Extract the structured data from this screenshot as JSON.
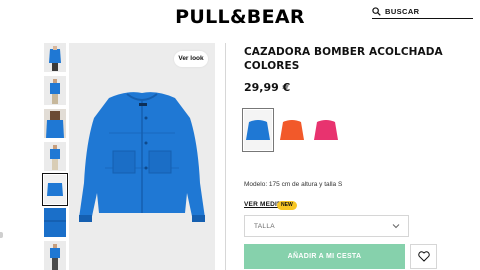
{
  "header": {
    "logo_text": "PULL&BEAR",
    "search_placeholder": "BUSCAR"
  },
  "gallery": {
    "thumbnails": [
      {
        "name": "thumb-front-view"
      },
      {
        "name": "thumb-model-front"
      },
      {
        "name": "thumb-model-close"
      },
      {
        "name": "thumb-model-side"
      },
      {
        "name": "thumb-jacket-flat",
        "selected": true
      },
      {
        "name": "thumb-detail-blue"
      },
      {
        "name": "thumb-model-full"
      }
    ],
    "ver_look_label": "Ver look"
  },
  "product": {
    "title": "CAZADORA BOMBER ACOLCHADA COLORES",
    "price": "29,99 €",
    "colors": [
      {
        "name": "azul",
        "hex": "#1f78d4",
        "selected": true
      },
      {
        "name": "naranja",
        "hex": "#f2592a",
        "selected": false
      },
      {
        "name": "rosa",
        "hex": "#e8336f",
        "selected": false
      }
    ],
    "model_info": "Modelo: 175 cm de altura y talla S",
    "ver_medidas_label": "VER MEDIDAS",
    "new_badge": "NEW",
    "size_select_label": "TALLA",
    "add_to_cart_label": "AÑADIR A MI CESTA"
  },
  "colors": {
    "add_button_bg": "#86d1ac",
    "jacket_blue": "#1f78d4",
    "new_badge_bg": "#f7c624"
  }
}
